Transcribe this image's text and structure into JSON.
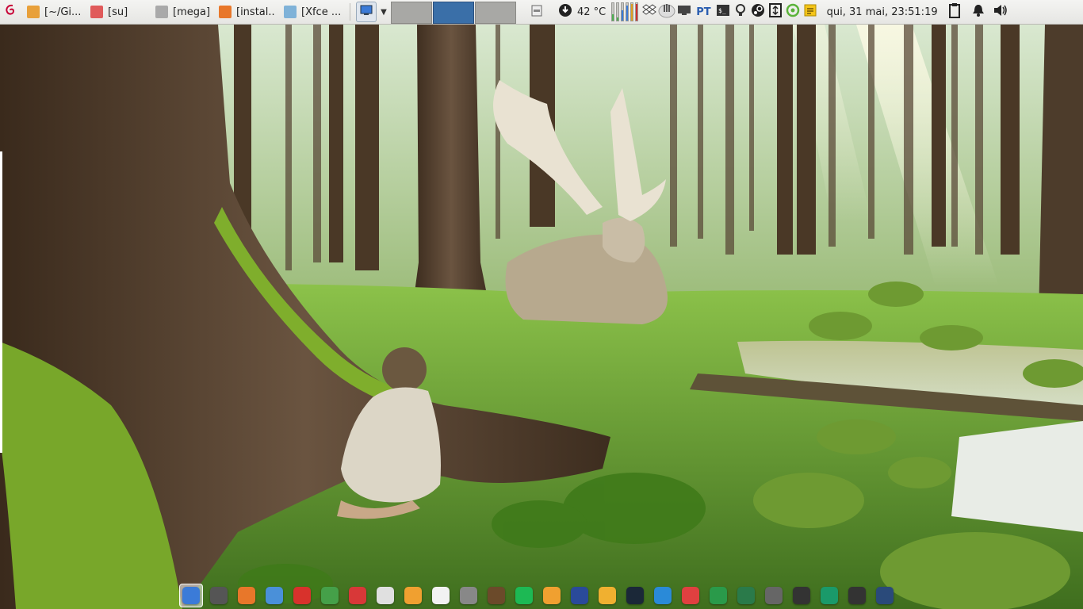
{
  "panel": {
    "tasks": [
      {
        "label": "[~/Gi...",
        "icon": "sublime-text-icon",
        "color": "#e8a03a"
      },
      {
        "label": "[su]",
        "icon": "terminal-icon",
        "color": "#e05a5a"
      },
      {
        "label": "[mega]",
        "icon": "folder-icon",
        "color": "#a9a9a9"
      },
      {
        "label": "[instal...",
        "icon": "firefox-icon",
        "color": "#e8772a"
      },
      {
        "label": "[Xfce ...",
        "icon": "window-icon",
        "color": "#7fb2d8"
      }
    ],
    "workspaces": [
      {
        "name": "workspace-1",
        "active": false
      },
      {
        "name": "workspace-2",
        "active": true
      },
      {
        "name": "workspace-3",
        "active": false
      }
    ],
    "temperature": "42 °C",
    "indicator_bars": [
      {
        "level": 0.35,
        "color": "#4caf50"
      },
      {
        "level": 0.2,
        "color": "#4caf50"
      },
      {
        "level": 0.6,
        "color": "#3b7bd8"
      },
      {
        "level": 0.85,
        "color": "#3b7bd8"
      },
      {
        "level": 0.95,
        "color": "#e0a020"
      },
      {
        "level": 0.95,
        "color": "#d03030"
      }
    ],
    "language": "PT",
    "clock": "qui, 31 mai, 23:51:19",
    "tray_icons": [
      "download-icon",
      "dropbox-icon",
      "hand-icon",
      "monitor-icon",
      "terminal-icon",
      "bulb-icon",
      "steam-icon",
      "arrows-icon",
      "target-icon",
      "notes-icon",
      "clipboard-icon",
      "bell-icon",
      "volume-icon"
    ]
  },
  "dock": {
    "items": [
      {
        "name": "show-desktop",
        "color": "#3b7bd8",
        "active": true
      },
      {
        "name": "files",
        "color": "#555555"
      },
      {
        "name": "firefox",
        "color": "#e8772a"
      },
      {
        "name": "chromium",
        "color": "#4a90d9"
      },
      {
        "name": "vivaldi",
        "color": "#d8322c"
      },
      {
        "name": "tree-app",
        "color": "#45a049"
      },
      {
        "name": "red-app",
        "color": "#d83838"
      },
      {
        "name": "document-app",
        "color": "#e0e0e0"
      },
      {
        "name": "sublime-text",
        "color": "#f0a030"
      },
      {
        "name": "text-editor",
        "color": "#f2f2f2"
      },
      {
        "name": "archive",
        "color": "#888888"
      },
      {
        "name": "owl-app",
        "color": "#6b4a2a"
      },
      {
        "name": "spotify",
        "color": "#1db954"
      },
      {
        "name": "moon-app",
        "color": "#f0a030"
      },
      {
        "name": "night-app",
        "color": "#2a4a9a"
      },
      {
        "name": "star-app",
        "color": "#f0b030"
      },
      {
        "name": "steam",
        "color": "#1b2838"
      },
      {
        "name": "monitor-app",
        "color": "#2a8ad8"
      },
      {
        "name": "transfer-app",
        "color": "#e04040"
      },
      {
        "name": "green-folder",
        "color": "#2a9a4a"
      },
      {
        "name": "cube-app",
        "color": "#2a7a4a"
      },
      {
        "name": "gray-app",
        "color": "#666666"
      },
      {
        "name": "tux",
        "color": "#333333"
      },
      {
        "name": "green-app",
        "color": "#1a9a6a"
      },
      {
        "name": "dark-app",
        "color": "#333333"
      },
      {
        "name": "chat-app",
        "color": "#2a4a7a"
      }
    ]
  }
}
